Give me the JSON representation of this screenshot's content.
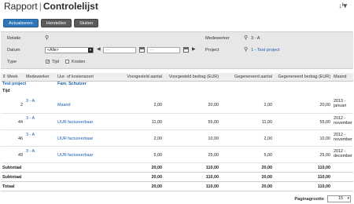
{
  "header": {
    "title": "Rapport",
    "subtitle": "Controlelijst",
    "menu_icon": "sort-menu-icon"
  },
  "toolbar": {
    "refresh": "Actualiseren",
    "reset": "Herstellen",
    "close": "Sluiten"
  },
  "filters": {
    "relatie_label": "Relatie",
    "datum_label": "Datum",
    "datum_value": "<Alle>",
    "date_from": "- -",
    "date_to": "- -",
    "type_label": "Type",
    "type_tijd": "Tijd",
    "type_kosten": "Kosten",
    "tijd_checked": true,
    "kosten_checked": false,
    "medewerker_label": "Medewerker",
    "medewerker_value": "3 - A",
    "project_label": "Project",
    "project_value": "1 - Test project"
  },
  "table": {
    "columns": [
      "Week",
      "Medewerker",
      "Uur- of kostensoort",
      "Voorgesteld aantal",
      "Voorgesteld bedrag (EUR)",
      "Gegenereerd aantal",
      "Gegenereerd bedrag (EUR)",
      "Maand"
    ],
    "sort_indicator": "⇕",
    "group_project": "Test project",
    "group_fam": "Fam. Schutzer",
    "group_type": "Tijd",
    "rows": [
      {
        "week": "2",
        "medewerker": "3 - A",
        "soort": "Maand",
        "va": "2,00",
        "vb": "20,00",
        "ga": "2,00",
        "gb": "20,00",
        "maand1": "2013 -",
        "maand2": "januari"
      },
      {
        "week": "44",
        "medewerker": "3 - A",
        "soort": "UUR factureerbaar",
        "va": "11,00",
        "vb": "55,00",
        "ga": "11,00",
        "gb": "55,00",
        "maand1": "2012 -",
        "maand2": "november"
      },
      {
        "week": "46",
        "medewerker": "3 - A",
        "soort": "UUR factureerbaar",
        "va": "2,00",
        "vb": "10,00",
        "ga": "2,00",
        "gb": "10,00",
        "maand1": "2012 -",
        "maand2": "november"
      },
      {
        "week": "49",
        "medewerker": "3 - A",
        "soort": "UUR factureerbaar",
        "va": "5,00",
        "vb": "25,00",
        "ga": "5,00",
        "gb": "25,00",
        "maand1": "2012 -",
        "maand2": "december"
      }
    ],
    "totals": [
      {
        "label": "Subtotaal",
        "va": "20,00",
        "vb": "110,00",
        "ga": "20,00",
        "gb": "110,00"
      },
      {
        "label": "Subtotaal",
        "va": "20,00",
        "vb": "110,00",
        "ga": "20,00",
        "gb": "110,00"
      },
      {
        "label": "Totaal",
        "va": "20,00",
        "vb": "110,00",
        "ga": "20,00",
        "gb": "110,00"
      }
    ]
  },
  "pager": {
    "label": "Paginagrootte",
    "value": "15"
  }
}
